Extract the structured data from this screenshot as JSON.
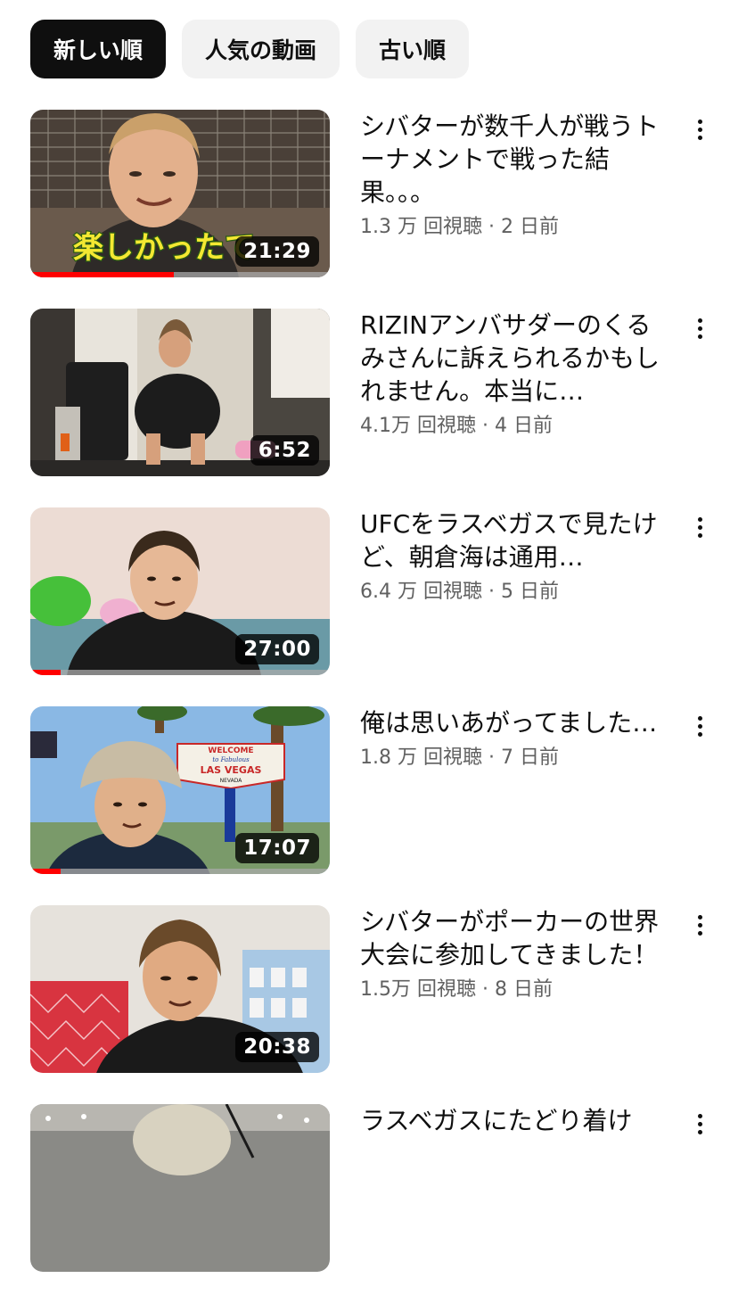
{
  "filters": [
    {
      "label": "新しい順",
      "active": true
    },
    {
      "label": "人気の動画",
      "active": false
    },
    {
      "label": "古い順",
      "active": false
    }
  ],
  "videos": [
    {
      "title": "シバターが数千人が戦うトーナメントで戦った結果。。。",
      "views": "1.3 万 回視聴",
      "age": "2 日前",
      "duration": "21:29",
      "caption": "楽しかったて",
      "watched_fraction": 0.48
    },
    {
      "title": "RIZINアンバサダーのくるみさんに訴えられるかもしれません。本当に…",
      "views": "4.1万 回視聴",
      "age": "4 日前",
      "duration": "6:52",
      "watched_fraction": 0
    },
    {
      "title": "UFCをラスベガスで見たけど、朝倉海は通用…",
      "views": "6.4 万 回視聴",
      "age": "5 日前",
      "duration": "27:00",
      "watched_fraction": 0.1
    },
    {
      "title": "俺は思いあがってました…",
      "views": "1.8 万 回視聴",
      "age": "7 日前",
      "duration": "17:07",
      "sign_lines": [
        "WELCOME",
        "to Fabulous",
        "LAS VEGAS",
        "NEVADA"
      ],
      "watched_fraction": 0.1
    },
    {
      "title": "シバターがポーカーの世界大会に参加してきました！",
      "views": "1.5万 回視聴",
      "age": "8 日前",
      "duration": "20:38",
      "watched_fraction": 0
    },
    {
      "title": "ラスベガスにたどり着け",
      "views": "",
      "age": "",
      "duration": "",
      "watched_fraction": 0
    }
  ],
  "separator": " · ",
  "icons": {
    "more": "more-vert-icon"
  },
  "colors": {
    "progress": "#ff0000",
    "chip_active": "#0f0f0f",
    "chip_inactive": "#f2f2f2"
  }
}
